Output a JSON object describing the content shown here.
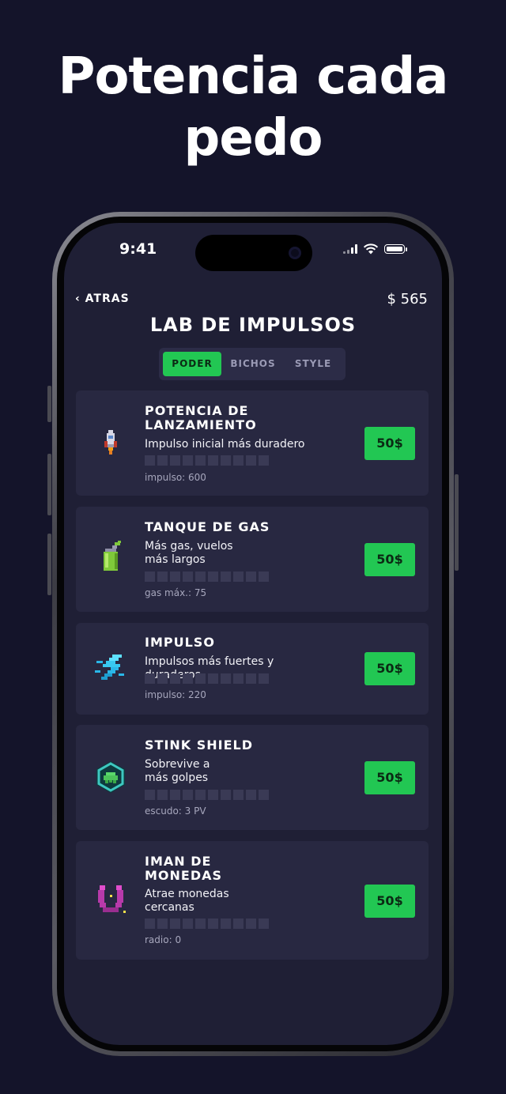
{
  "headline": {
    "line1": "Potencia cada",
    "line2": "pedo"
  },
  "status": {
    "time": "9:41"
  },
  "nav": {
    "back_label": "ATRAS",
    "back_chevron": "‹",
    "money": "$ 565"
  },
  "screen_title": "LAB DE IMPULSOS",
  "tabs": [
    {
      "label": "PODER",
      "active": true
    },
    {
      "label": "BICHOS",
      "active": false
    },
    {
      "label": "STYLE",
      "active": false
    }
  ],
  "upgrades": [
    {
      "name_l1": "POTENCIA DE",
      "name_l2": "LANZAMIENTO",
      "desc_l1": "Impulso inicial más duradero",
      "desc_l2": "",
      "stat": "impulso: 600",
      "price": "50$",
      "icon": "rocket-icon",
      "level": 0,
      "max_level": 10
    },
    {
      "name_l1": "TANQUE DE GAS",
      "name_l2": "",
      "desc_l1": "Más gas, vuelos",
      "desc_l2": "más largos",
      "stat": "gas máx.: 75",
      "price": "50$",
      "icon": "gas-can-icon",
      "level": 0,
      "max_level": 10
    },
    {
      "name_l1": "IMPULSO",
      "name_l2": "",
      "desc_l1": "Impulsos más fuertes y duraderos",
      "desc_l2": "",
      "stat": "impulso: 220",
      "price": "50$",
      "icon": "lightning-icon",
      "level": 0,
      "max_level": 10
    },
    {
      "name_l1": "STINK SHIELD",
      "name_l2": "",
      "desc_l1": "Sobrevive a",
      "desc_l2": "más golpes",
      "stat": "escudo: 3 PV",
      "price": "50$",
      "icon": "shield-icon",
      "level": 0,
      "max_level": 10
    },
    {
      "name_l1": "IMAN DE",
      "name_l2": "MONEDAS",
      "desc_l1": "Atrae monedas",
      "desc_l2": "cercanas",
      "stat": "radio: 0",
      "price": "50$",
      "icon": "magnet-icon",
      "level": 0,
      "max_level": 10
    }
  ],
  "colors": {
    "accent": "#22c753",
    "card": "#282841",
    "background": "#14142a",
    "screen": "#1f1f35"
  }
}
